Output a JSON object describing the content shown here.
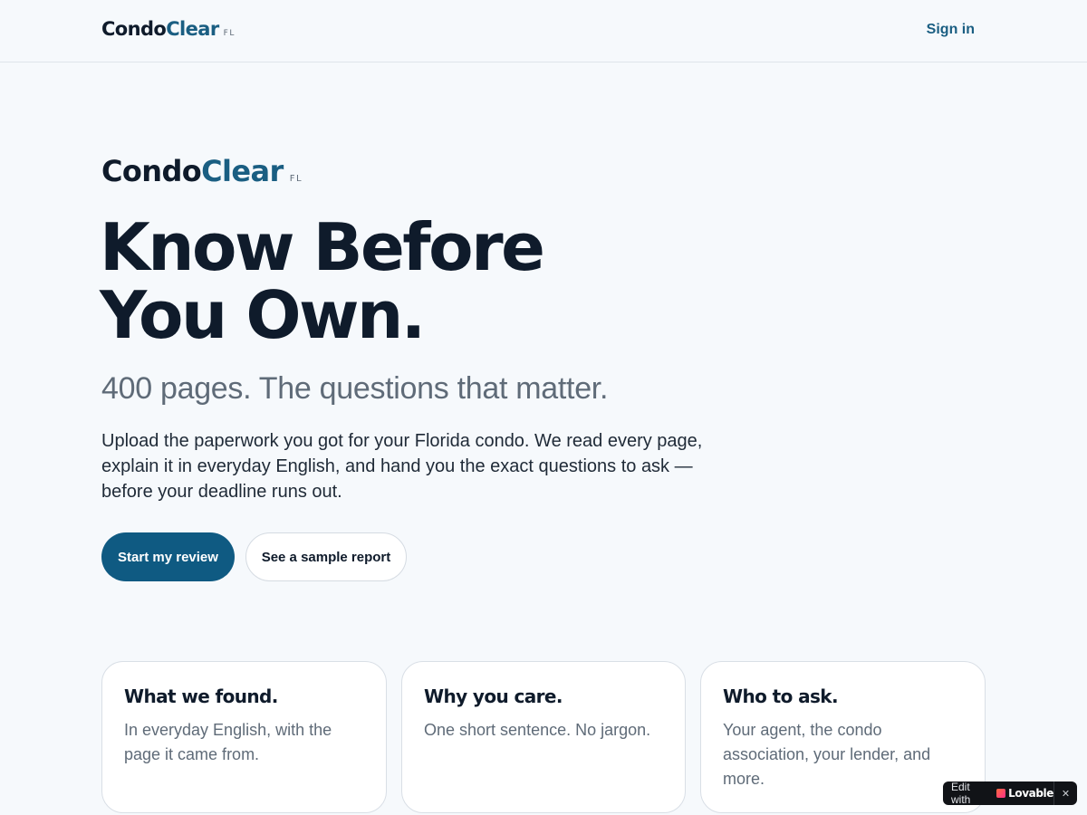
{
  "header": {
    "logo": {
      "condo": "Condo",
      "clear": "Clear",
      "suffix": "FL"
    },
    "signin_label": "Sign in"
  },
  "hero": {
    "logo": {
      "condo": "Condo",
      "clear": "Clear",
      "suffix": "FL"
    },
    "headline_line1": "Know Before",
    "headline_line2": "You Own.",
    "subhead": "400 pages. The questions that matter.",
    "body": "Upload the paperwork you got for your Florida condo. We read every page, explain it in everyday English, and hand you the exact questions to ask — before your deadline runs out.",
    "primary_cta": "Start my review",
    "secondary_cta": "See a sample report"
  },
  "cards": [
    {
      "title": "What we found.",
      "description": "In everyday English, with the page it came from."
    },
    {
      "title": "Why you care.",
      "description": "One short sentence. No jargon."
    },
    {
      "title": "Who to ask.",
      "description": "Your agent, the condo association, your lender, and more."
    }
  ],
  "badge": {
    "edit_label": "Edit with",
    "brand_label": "Lovable",
    "close_glyph": "✕",
    "icon": "lovable-heart-icon"
  },
  "colors": {
    "background": "#f6f9fc",
    "brand_dark": "#0f1b2b",
    "brand_accent": "#1a5e82",
    "primary_button": "#0f5a82",
    "muted_text": "#5f6b78"
  }
}
